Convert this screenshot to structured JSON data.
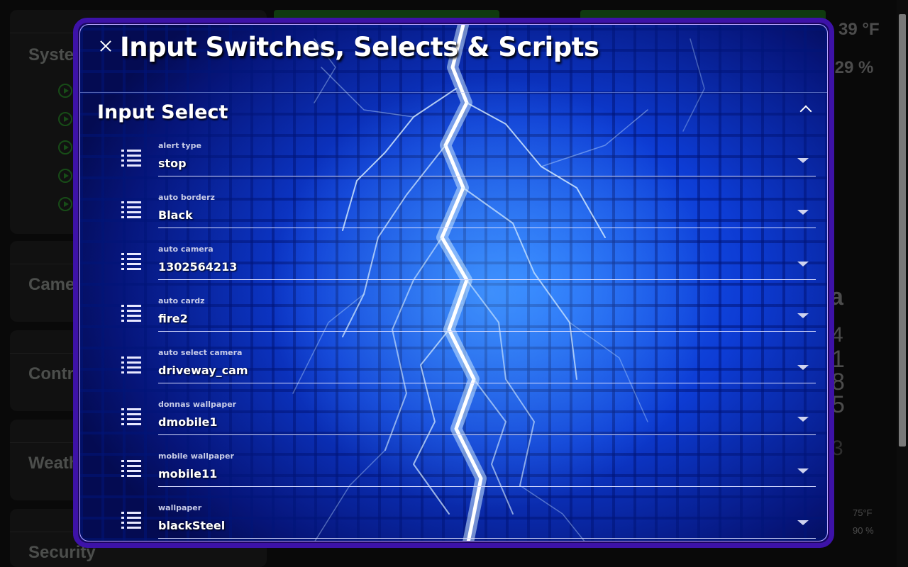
{
  "background": {
    "cards": [
      "Syste",
      "Came",
      "Contr",
      "Weath",
      "Security"
    ],
    "right_values": [
      "39 °F",
      ".29 %",
      "a",
      "4",
      "1",
      "8",
      "5",
      "3",
      "75°F",
      "90 %"
    ]
  },
  "dialog": {
    "title": "Input Switches, Selects & Scripts",
    "section_title": "Input Select",
    "selects": [
      {
        "label": "alert type",
        "value": "stop"
      },
      {
        "label": "auto borderz",
        "value": "Black"
      },
      {
        "label": "auto camera",
        "value": "1302564213"
      },
      {
        "label": "auto cardz",
        "value": "fire2"
      },
      {
        "label": "auto select camera",
        "value": "driveway_cam"
      },
      {
        "label": "donnas wallpaper",
        "value": "dmobile1"
      },
      {
        "label": "mobile wallpaper",
        "value": "mobile11"
      },
      {
        "label": "wallpaper",
        "value": "blackSteel"
      }
    ]
  },
  "icons": {
    "close": "close-icon",
    "collapse": "chevron-up-icon",
    "row": "format-list-bulleted-icon",
    "dropdown": "menu-down-icon",
    "play": "play-circle-icon"
  },
  "colors": {
    "dialog_border": "#3d12a8",
    "dialog_background": "#0d3cd4",
    "bg_accent_green": "#1c6a1c"
  }
}
